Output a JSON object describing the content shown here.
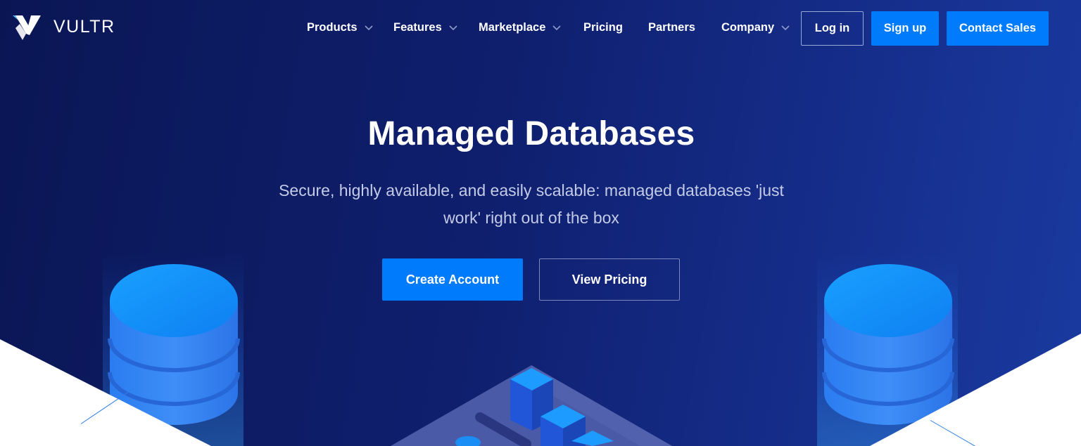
{
  "brand": {
    "name": "VULTR"
  },
  "nav": {
    "items": [
      {
        "label": "Products",
        "dropdown": true
      },
      {
        "label": "Features",
        "dropdown": true
      },
      {
        "label": "Marketplace",
        "dropdown": true
      },
      {
        "label": "Pricing",
        "dropdown": false
      },
      {
        "label": "Partners",
        "dropdown": false
      },
      {
        "label": "Company",
        "dropdown": true
      }
    ],
    "login_label": "Log in",
    "signup_label": "Sign up",
    "contact_label": "Contact Sales"
  },
  "hero": {
    "title": "Managed Databases",
    "subtitle": "Secure, highly available, and easily scalable: managed databases 'just work' right out of the box",
    "primary_cta": "Create Account",
    "secondary_cta": "View Pricing"
  },
  "colors": {
    "accent": "#007bfc",
    "background_dark": "#0a1654",
    "background_light": "#1a3aa0"
  },
  "icons": [
    "vultr-logo-icon",
    "chevron-down-icon",
    "database-cylinder-icon",
    "server-blocks-icon"
  ]
}
